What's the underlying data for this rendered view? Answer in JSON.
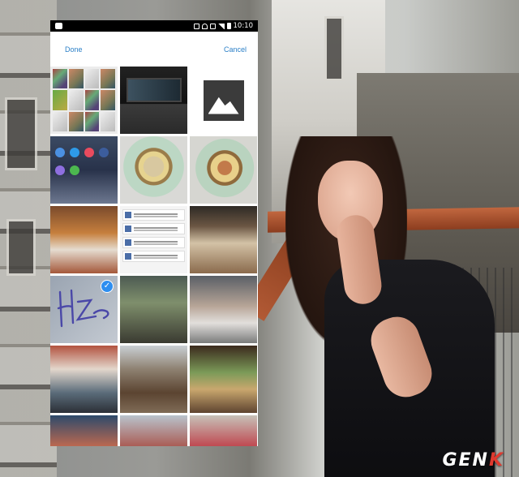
{
  "status_bar": {
    "time": "10:10"
  },
  "toolbar": {
    "done_label": "Done",
    "cancel_label": "Cancel"
  },
  "watermark": {
    "main": "GEN",
    "accent": "K"
  },
  "colors": {
    "accent": "#2a7fc7",
    "check": "#2e8ef0",
    "brand_accent": "#e03a2f"
  },
  "gallery": {
    "selected_index": 9,
    "items": [
      "screenshot-collage",
      "tv-photo",
      "image-placeholder",
      "homescreen-screenshot",
      "food-bowl-photo",
      "food-bowl-photo",
      "cafe-photo",
      "chat-screenshot",
      "table-photo",
      "signature-image",
      "street-photo",
      "man-photo",
      "group-photo",
      "outdoor-shed-photo",
      "dinner-photo",
      "group-photo",
      "people-photo",
      "people-photo"
    ]
  }
}
